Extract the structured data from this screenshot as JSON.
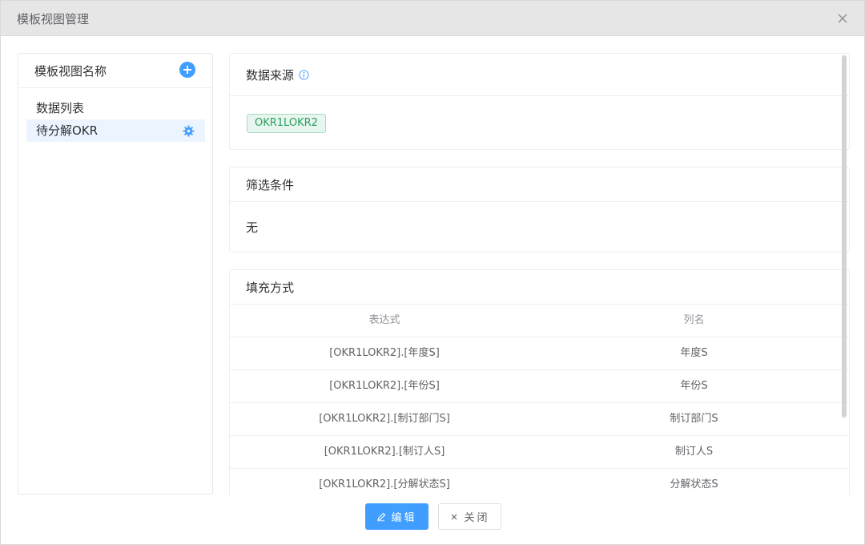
{
  "dialog": {
    "title": "模板视图管理",
    "close_icon": "close-icon"
  },
  "left_panel": {
    "title": "模板视图名称",
    "add_icon": "plus-circle-icon",
    "items": [
      {
        "label": "数据列表",
        "active": false
      },
      {
        "label": "待分解OKR",
        "active": true,
        "icon": "gear-icon"
      }
    ]
  },
  "data_source": {
    "title": "数据来源",
    "info_icon": "info-icon",
    "tag": "OKR1LOKR2"
  },
  "filter": {
    "title": "筛选条件",
    "value": "无"
  },
  "fill": {
    "title": "填充方式",
    "columns": [
      "表达式",
      "列名"
    ],
    "rows": [
      {
        "expr": "[OKR1LOKR2].[年度S]",
        "col": "年度S"
      },
      {
        "expr": "[OKR1LOKR2].[年份S]",
        "col": "年份S"
      },
      {
        "expr": "[OKR1LOKR2].[制订部门S]",
        "col": "制订部门S"
      },
      {
        "expr": "[OKR1LOKR2].[制订人S]",
        "col": "制订人S"
      },
      {
        "expr": "[OKR1LOKR2].[分解状态S]",
        "col": "分解状态S"
      }
    ]
  },
  "footer": {
    "edit_label": "编辑",
    "edit_icon": "pencil-icon",
    "close_label": "关闭",
    "close_icon": "close-icon"
  },
  "colors": {
    "primary": "#409eff",
    "tag_bg": "#e7f6ee",
    "tag_text": "#2e9e63",
    "header_bg": "#e6e6e6"
  }
}
